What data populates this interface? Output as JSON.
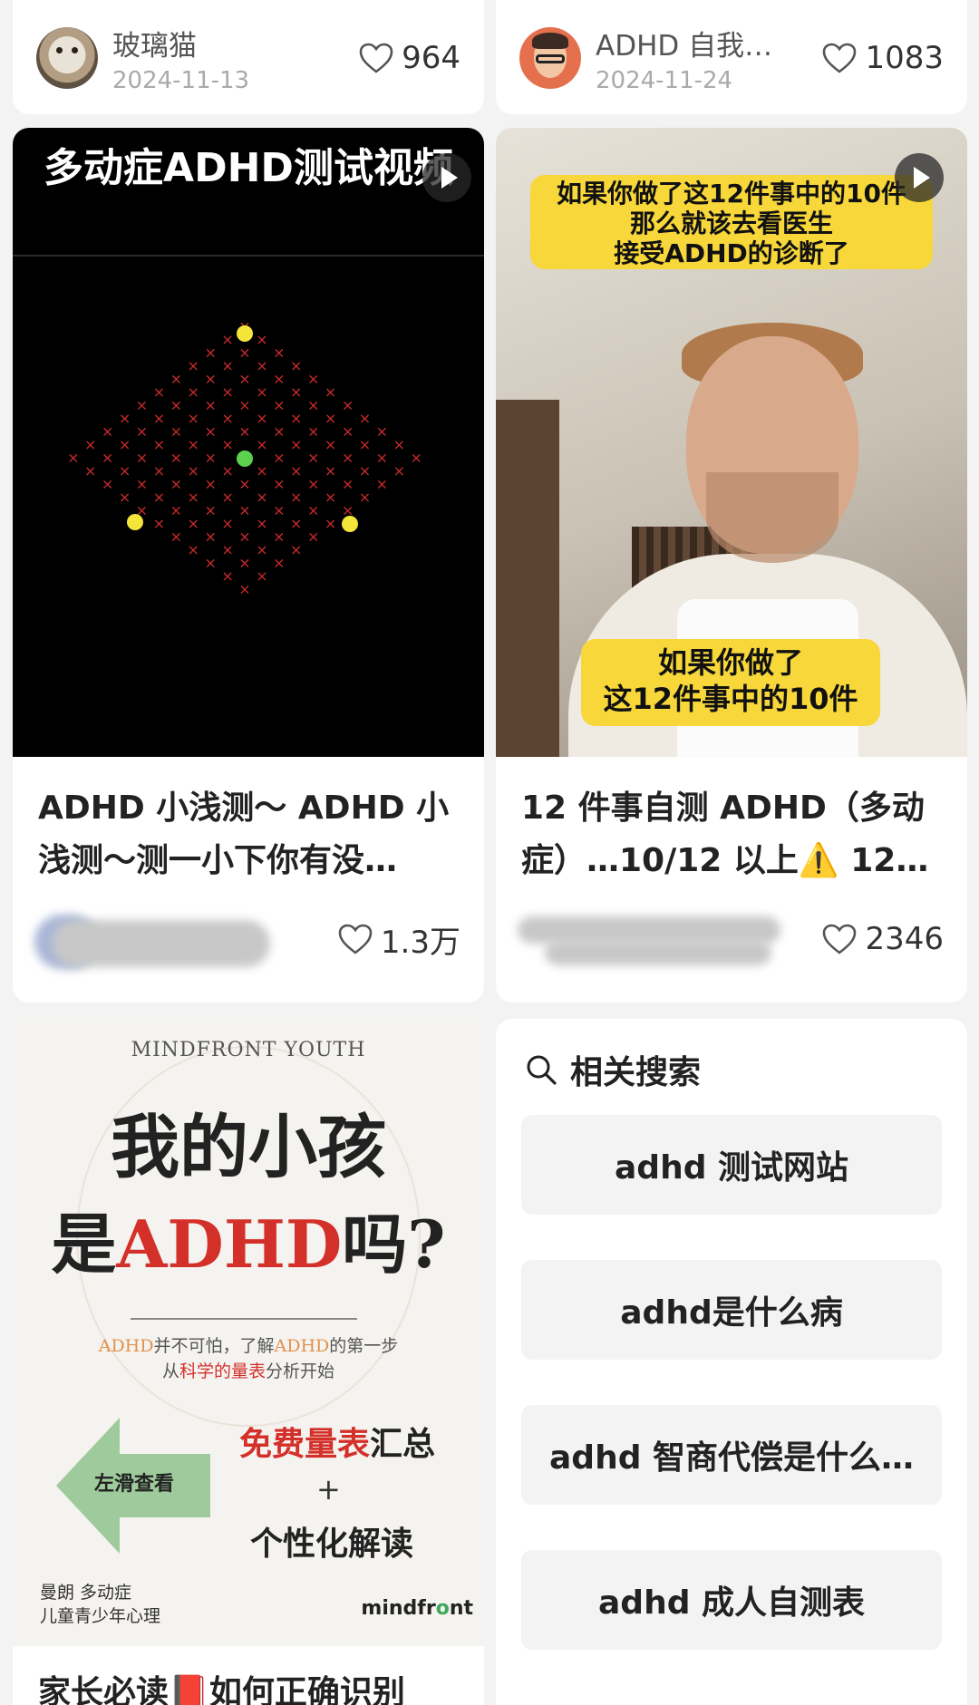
{
  "top_cards": [
    {
      "author": "玻璃猫",
      "date": "2024-11-13",
      "likes": "964"
    },
    {
      "author": "ADHD 自我…",
      "date": "2024-11-24",
      "likes": "1083"
    }
  ],
  "posts": [
    {
      "thumb_title": "多动症ADHD测试视频",
      "title_line1": "ADHD 小浅测～ ADHD 小",
      "title_line2": "浅测～测一小下你有没…",
      "likes": "1.3万"
    },
    {
      "banner_top_line1": "如果你做了这12件事中的10件",
      "banner_top_line2": "那么就该去看医生",
      "banner_top_line3": "接受ADHD的诊断了",
      "banner_bottom_line1": "如果你做了",
      "banner_bottom_line2": "这12件事中的10件",
      "title_line1": "12 件事自测 ADHD（多动",
      "title_line2": "症）…10/12 以上⚠️ 12…",
      "likes": "2346"
    }
  ],
  "poster": {
    "brand": "MINDFRONT YOUTH",
    "headline1": "我的小孩",
    "headline2_pre": "是",
    "headline2_red": "ADHD",
    "headline2_post": "吗?",
    "sub1_a": "ADHD",
    "sub1_b": "并不可怕，了解",
    "sub1_c": "ADHD",
    "sub1_d": "的第一步",
    "sub2_a": "从",
    "sub2_b": "科学的量表",
    "sub2_c": "分析开始",
    "arrow_label": "左滑查看",
    "free_red": "免费量表",
    "free_black": "汇总",
    "plus": "+",
    "personal": "个性化解读",
    "footer_line1": "曼朗 多动症",
    "footer_line2": "儿童青少年心理",
    "logo_a": "mindfr",
    "logo_b": "o",
    "logo_c": "nt",
    "title": "家长必读📕如何正确识别"
  },
  "related": {
    "heading": "相关搜索",
    "items": [
      "adhd 测试网站",
      "adhd是什么病",
      "adhd 智商代偿是什么…",
      "adhd 成人自测表"
    ]
  }
}
